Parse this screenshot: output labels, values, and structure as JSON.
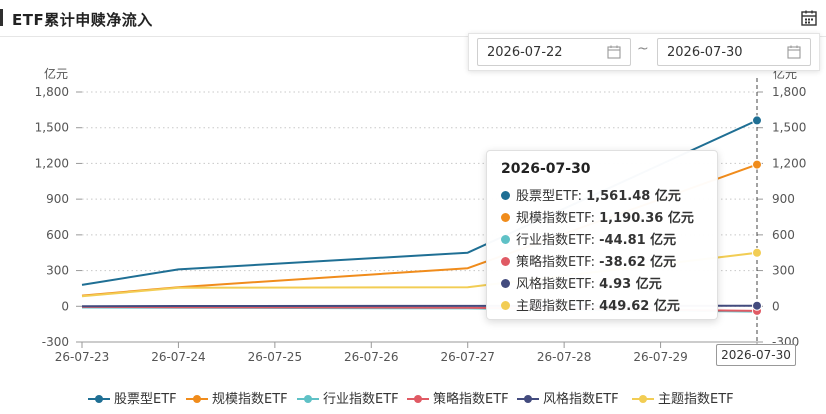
{
  "header": {
    "title": "ETF累计申赎净流入"
  },
  "date_range": {
    "start": "2026-07-22",
    "end": "2026-07-30",
    "separator": "~"
  },
  "tooltip": {
    "date": "2026-07-30",
    "unit": "亿元",
    "rows": [
      {
        "name": "股票型ETF",
        "value": "1,561.48",
        "color": "#1f6f94"
      },
      {
        "name": "规模指数ETF",
        "value": "1,190.36",
        "color": "#f08c1c"
      },
      {
        "name": "行业指数ETF",
        "value": "-44.81",
        "color": "#5fc1c6"
      },
      {
        "name": "策略指数ETF",
        "value": "-38.62",
        "color": "#e05a64"
      },
      {
        "name": "风格指数ETF",
        "value": "4.93",
        "color": "#434b7e"
      },
      {
        "name": "主题指数ETF",
        "value": "449.62",
        "color": "#f2cd54"
      }
    ]
  },
  "axis_badge": "2026-07-30",
  "chart_data": {
    "type": "line",
    "ylabel_left": "亿元",
    "ylabel_right": "亿元",
    "ylim": [
      -300,
      1800
    ],
    "yticks": [
      -300,
      0,
      300,
      600,
      900,
      1200,
      1500,
      1800
    ],
    "ytick_labels": [
      "-300",
      "0",
      "300",
      "600",
      "900",
      "1,200",
      "1,500",
      "1,800"
    ],
    "x": [
      "2026-07-23",
      "2026-07-24",
      "2026-07-25",
      "2026-07-26",
      "2026-07-27",
      "2026-07-28",
      "2026-07-29",
      "2026-07-30"
    ],
    "x_tick_labels": [
      "26-07-23",
      "26-07-24",
      "26-07-25",
      "26-07-26",
      "26-07-27",
      "26-07-28",
      "26-07-29",
      "26-07-30"
    ],
    "grid": true,
    "legend_position": "bottom",
    "series": [
      {
        "name": "股票型ETF",
        "color": "#1f6f94",
        "x": [
          "2026-07-23",
          "2026-07-24",
          "2026-07-27",
          "2026-07-30"
        ],
        "values": [
          180,
          310,
          450,
          1561.48
        ]
      },
      {
        "name": "规模指数ETF",
        "color": "#f08c1c",
        "x": [
          "2026-07-23",
          "2026-07-24",
          "2026-07-27",
          "2026-07-30"
        ],
        "values": [
          90,
          160,
          320,
          1190.36
        ]
      },
      {
        "name": "行业指数ETF",
        "color": "#5fc1c6",
        "x": [
          "2026-07-23",
          "2026-07-24",
          "2026-07-27",
          "2026-07-30"
        ],
        "values": [
          -10,
          -12,
          -18,
          -44.81
        ]
      },
      {
        "name": "策略指数ETF",
        "color": "#e05a64",
        "x": [
          "2026-07-23",
          "2026-07-24",
          "2026-07-27",
          "2026-07-30"
        ],
        "values": [
          -5,
          -8,
          -12,
          -38.62
        ]
      },
      {
        "name": "风格指数ETF",
        "color": "#434b7e",
        "x": [
          "2026-07-23",
          "2026-07-24",
          "2026-07-27",
          "2026-07-30"
        ],
        "values": [
          0,
          2,
          3,
          4.93
        ]
      },
      {
        "name": "主题指数ETF",
        "color": "#f2cd54",
        "x": [
          "2026-07-23",
          "2026-07-24",
          "2026-07-27",
          "2026-07-30"
        ],
        "values": [
          85,
          155,
          160,
          449.62
        ]
      }
    ]
  }
}
